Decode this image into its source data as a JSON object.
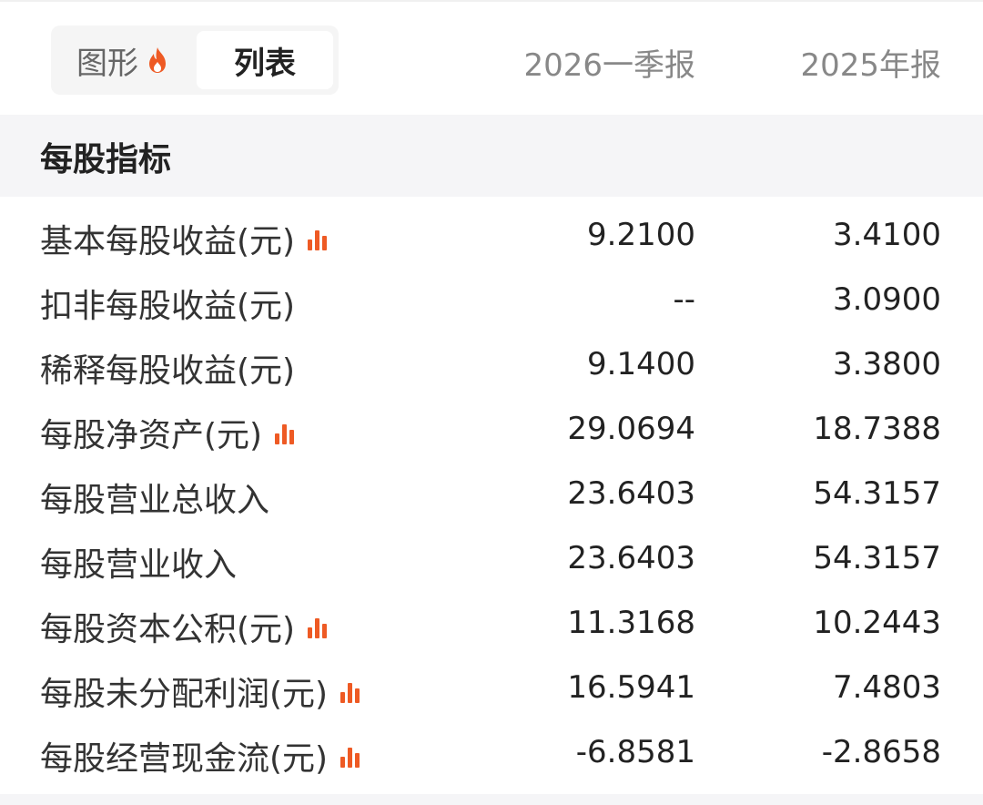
{
  "header": {
    "tab_graph": "图形",
    "tab_list": "列表",
    "col1": "2026一季报",
    "col2": "2025年报"
  },
  "section": {
    "title": "每股指标"
  },
  "accent_color": "#ee5a24",
  "rows": [
    {
      "label": "基本每股收益(元)",
      "chart_icon": true,
      "v1": "9.2100",
      "v2": "3.4100"
    },
    {
      "label": "扣非每股收益(元)",
      "chart_icon": false,
      "v1": "--",
      "v2": "3.0900"
    },
    {
      "label": "稀释每股收益(元)",
      "chart_icon": false,
      "v1": "9.1400",
      "v2": "3.3800"
    },
    {
      "label": "每股净资产(元)",
      "chart_icon": true,
      "v1": "29.0694",
      "v2": "18.7388"
    },
    {
      "label": "每股营业总收入",
      "chart_icon": false,
      "v1": "23.6403",
      "v2": "54.3157"
    },
    {
      "label": "每股营业收入",
      "chart_icon": false,
      "v1": "23.6403",
      "v2": "54.3157"
    },
    {
      "label": "每股资本公积(元)",
      "chart_icon": true,
      "v1": "11.3168",
      "v2": "10.2443"
    },
    {
      "label": "每股未分配利润(元)",
      "chart_icon": true,
      "v1": "16.5941",
      "v2": "7.4803"
    },
    {
      "label": "每股经营现金流(元)",
      "chart_icon": true,
      "v1": "-6.8581",
      "v2": "-2.8658"
    }
  ]
}
